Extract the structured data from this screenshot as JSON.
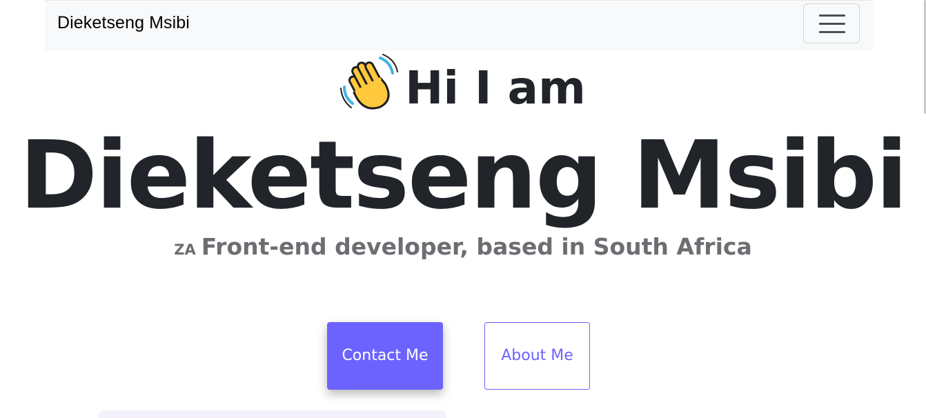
{
  "navbar": {
    "brand": "Dieketseng Msibi",
    "toggler_icon": "hamburger-menu-icon",
    "background": "#f8f9fa"
  },
  "hero": {
    "wave_icon": "waving-hand-icon",
    "greeting": "Hi I am",
    "name": "Dieketseng Msibi",
    "flag_code": "ZA",
    "subtitle": "Front-end developer, based in South Africa"
  },
  "buttons": {
    "contact_label": "Contact Me",
    "about_label": "About Me"
  },
  "colors": {
    "accent": "#6c63ff",
    "heading": "#212529",
    "muted": "#6c6e72"
  }
}
